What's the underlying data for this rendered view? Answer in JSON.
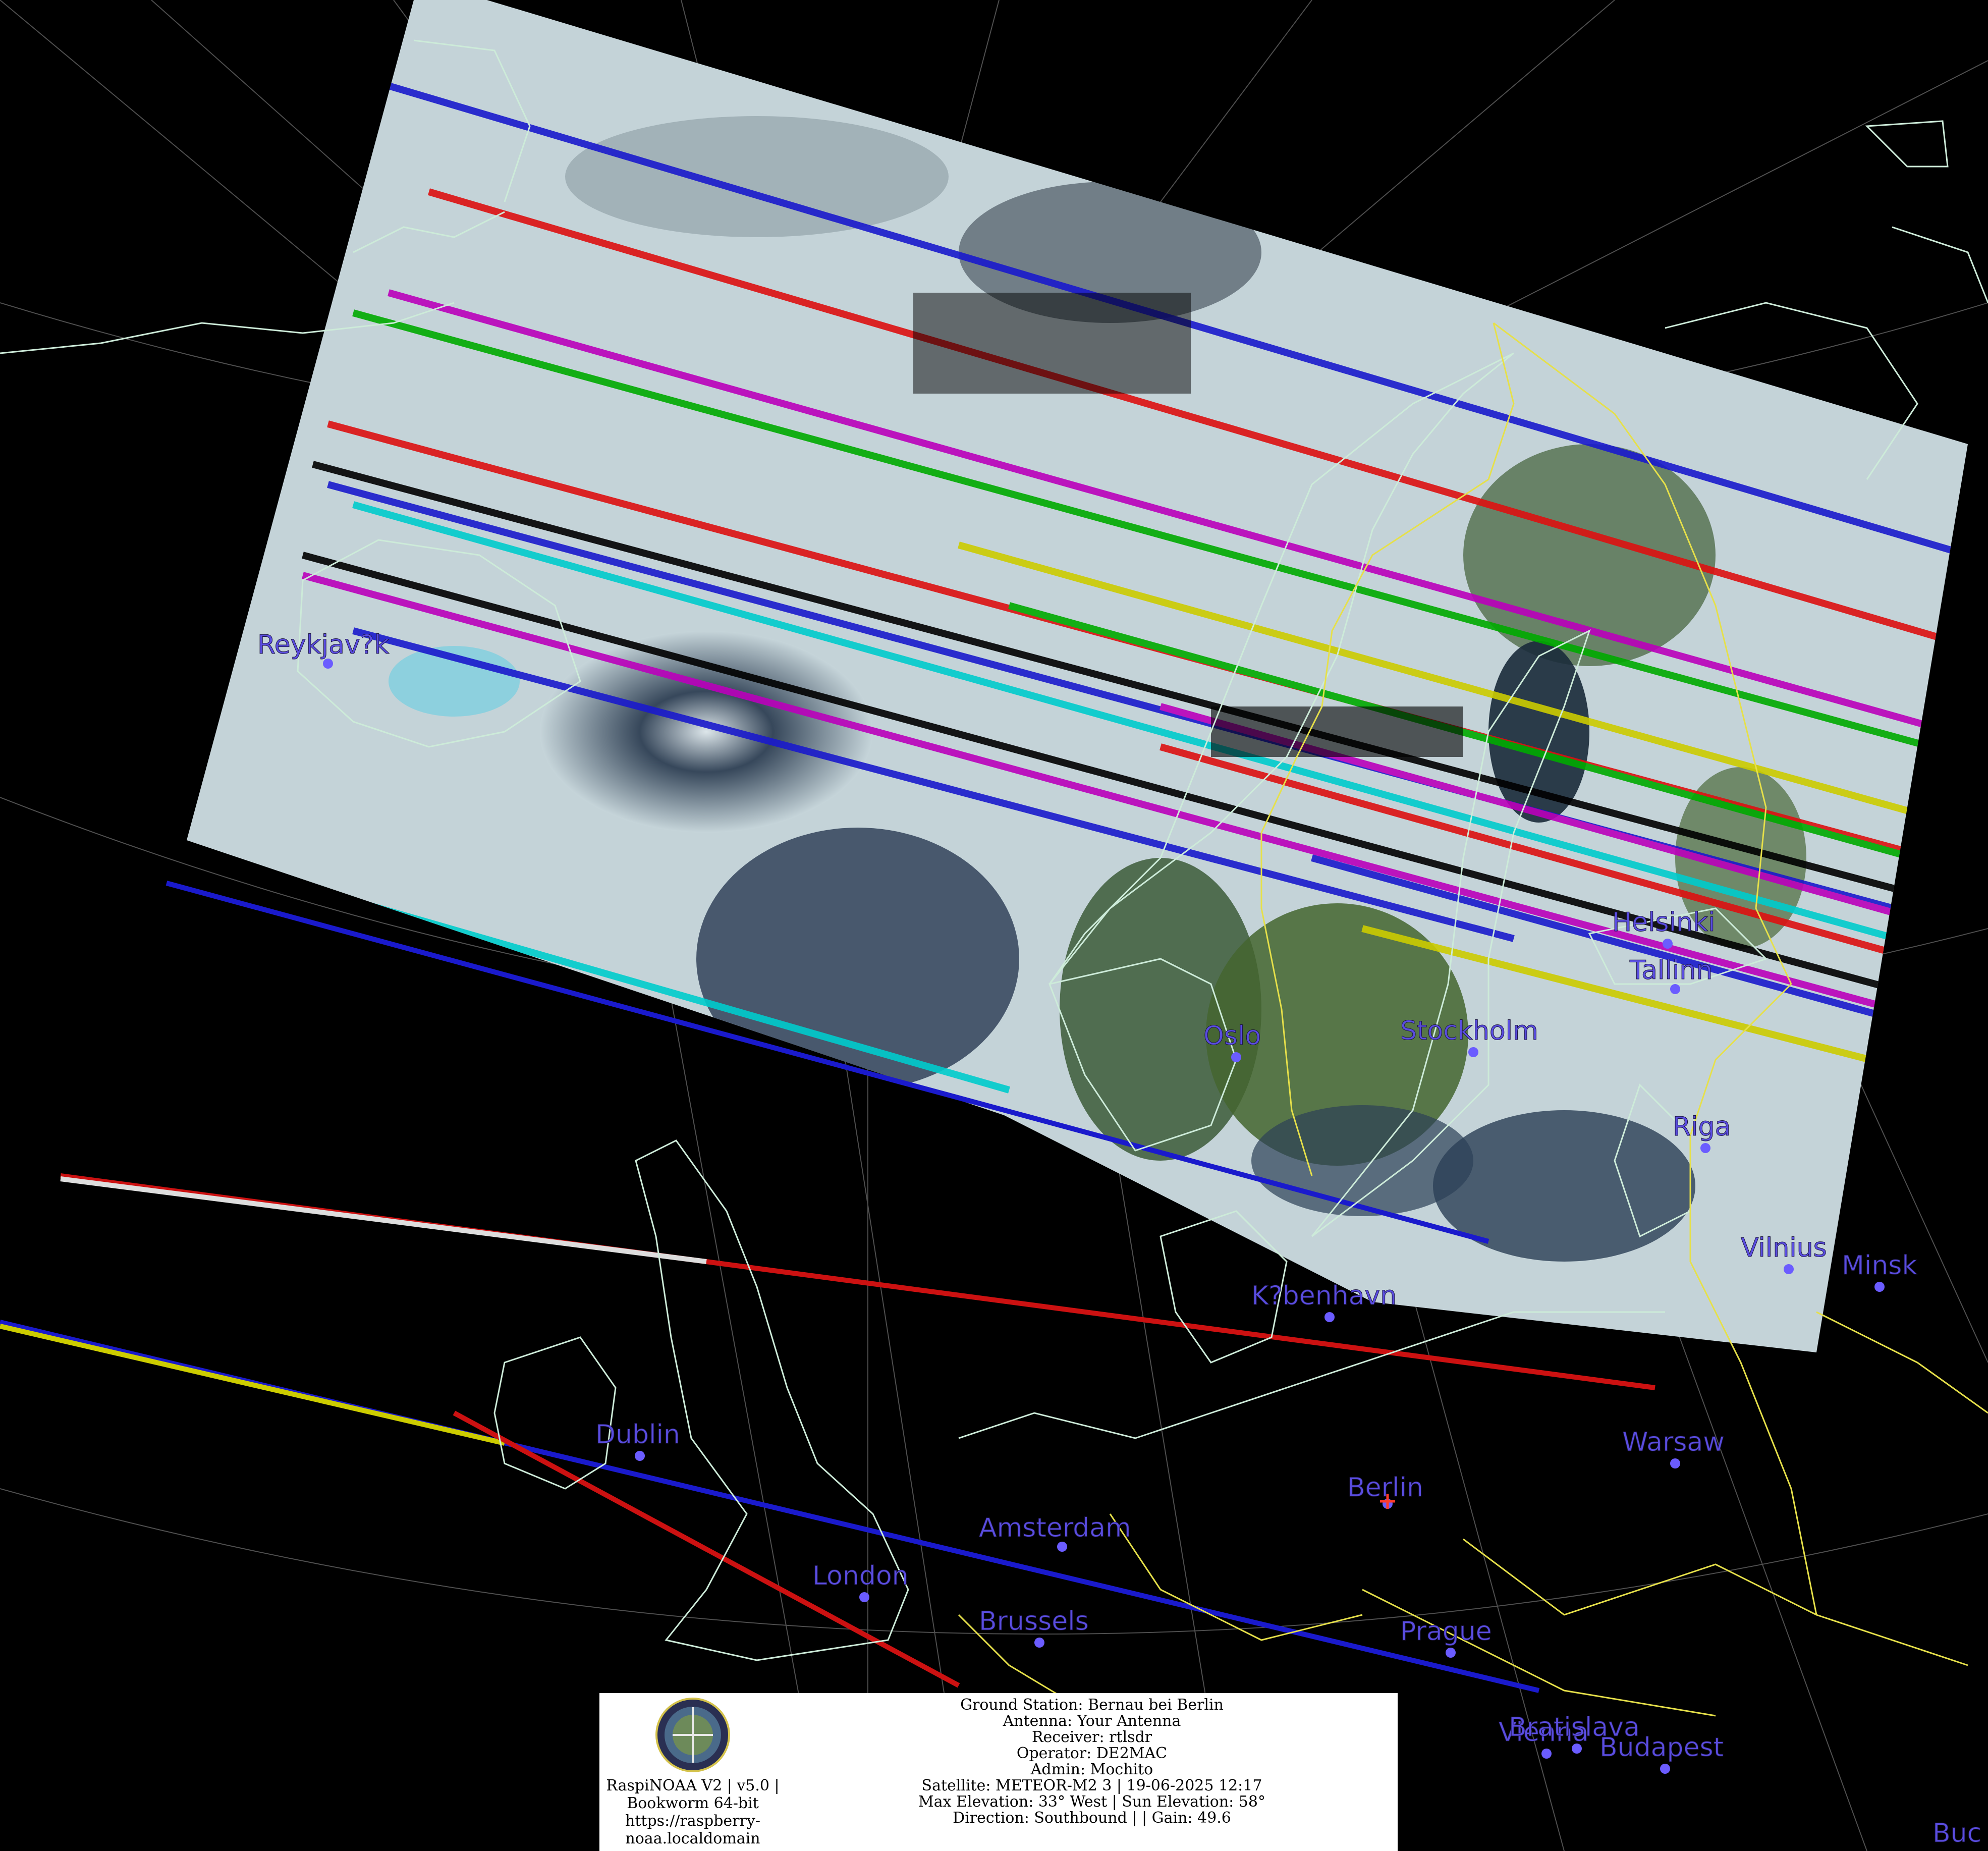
{
  "colors": {
    "background": "#000000",
    "coastline": "#cdebd9",
    "border": "#e6e04a",
    "graticule": "#7a7a7a",
    "city": "#5a4de0",
    "cloud": "#d6e2e6",
    "ocean": "#1e2b3d",
    "land": "#4a6a34"
  },
  "cities": [
    {
      "name": "Reykjav?k"
    },
    {
      "name": "Helsinki"
    },
    {
      "name": "Tallinn"
    },
    {
      "name": "Oslo"
    },
    {
      "name": "Stockholm"
    },
    {
      "name": "Riga"
    },
    {
      "name": "Vilnius"
    },
    {
      "name": "Minsk"
    },
    {
      "name": "K?benhavn"
    },
    {
      "name": "Dublin"
    },
    {
      "name": "Warsaw"
    },
    {
      "name": "Berlin"
    },
    {
      "name": "Amsterdam"
    },
    {
      "name": "London"
    },
    {
      "name": "Brussels"
    },
    {
      "name": "Prague"
    },
    {
      "name": "Vienna"
    },
    {
      "name": "Bratislava"
    },
    {
      "name": "Budapest"
    },
    {
      "name": "Buc"
    }
  ],
  "info": {
    "logo_icon": "raspinoaa-logo-icon",
    "system_lines": [
      "RaspiNOAA V2 | v5.0 |",
      "Bookworm 64-bit",
      "https://raspberry-",
      "noaa.localdomain"
    ],
    "station_lines": [
      "Ground Station: Bernau bei Berlin",
      "Antenna: Your Antenna",
      "Receiver: rtlsdr",
      "Operator: DE2MAC",
      "Admin: Mochito",
      "Satellite: METEOR-M2 3 | 19-06-2025 12:17",
      "Max Elevation: 33° West | Sun Elevation: 58°",
      "Direction: Southbound | | Gain: 49.6"
    ]
  }
}
